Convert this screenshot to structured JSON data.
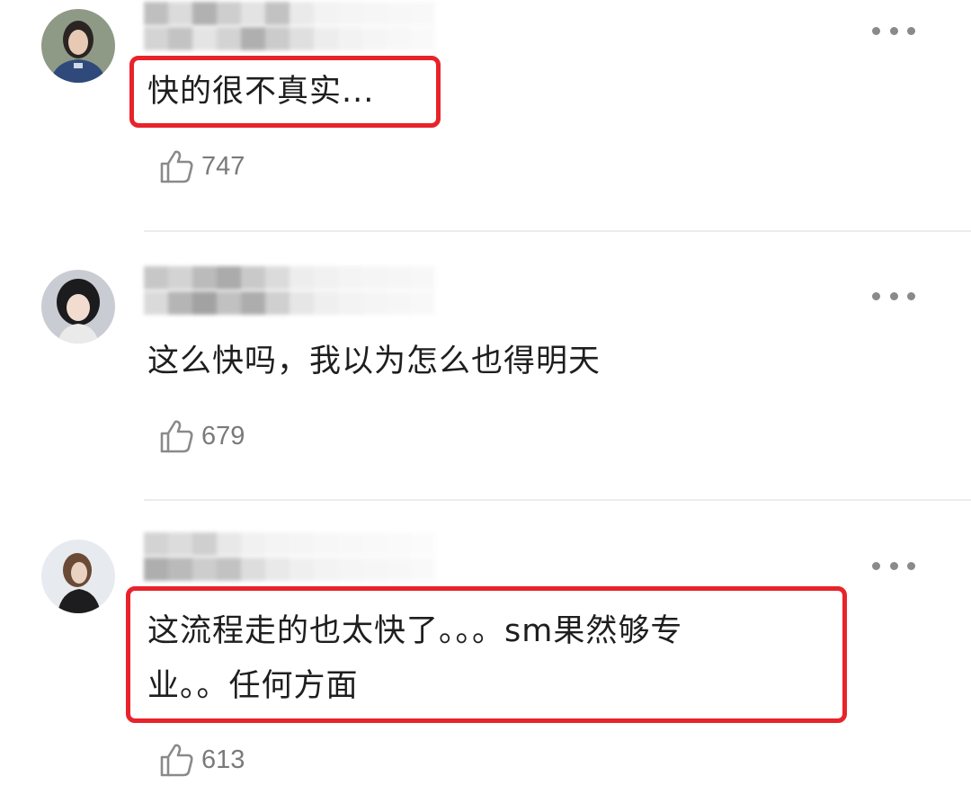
{
  "comments": [
    {
      "text": "快的很不真实...",
      "likes": "747"
    },
    {
      "text": "这么快吗，我以为怎么也得明天",
      "likes": "679"
    },
    {
      "text_line1": "这流程走的也太快了。。。sm果然够专",
      "text_line2": "业。。任何方面",
      "likes": "613"
    }
  ],
  "colors": {
    "highlight_box": "#e8232a",
    "like_count": "#7a7a7a",
    "divider": "#ececec"
  },
  "icons": [
    "avatar",
    "more-options-icon",
    "thumbs-up-icon"
  ]
}
